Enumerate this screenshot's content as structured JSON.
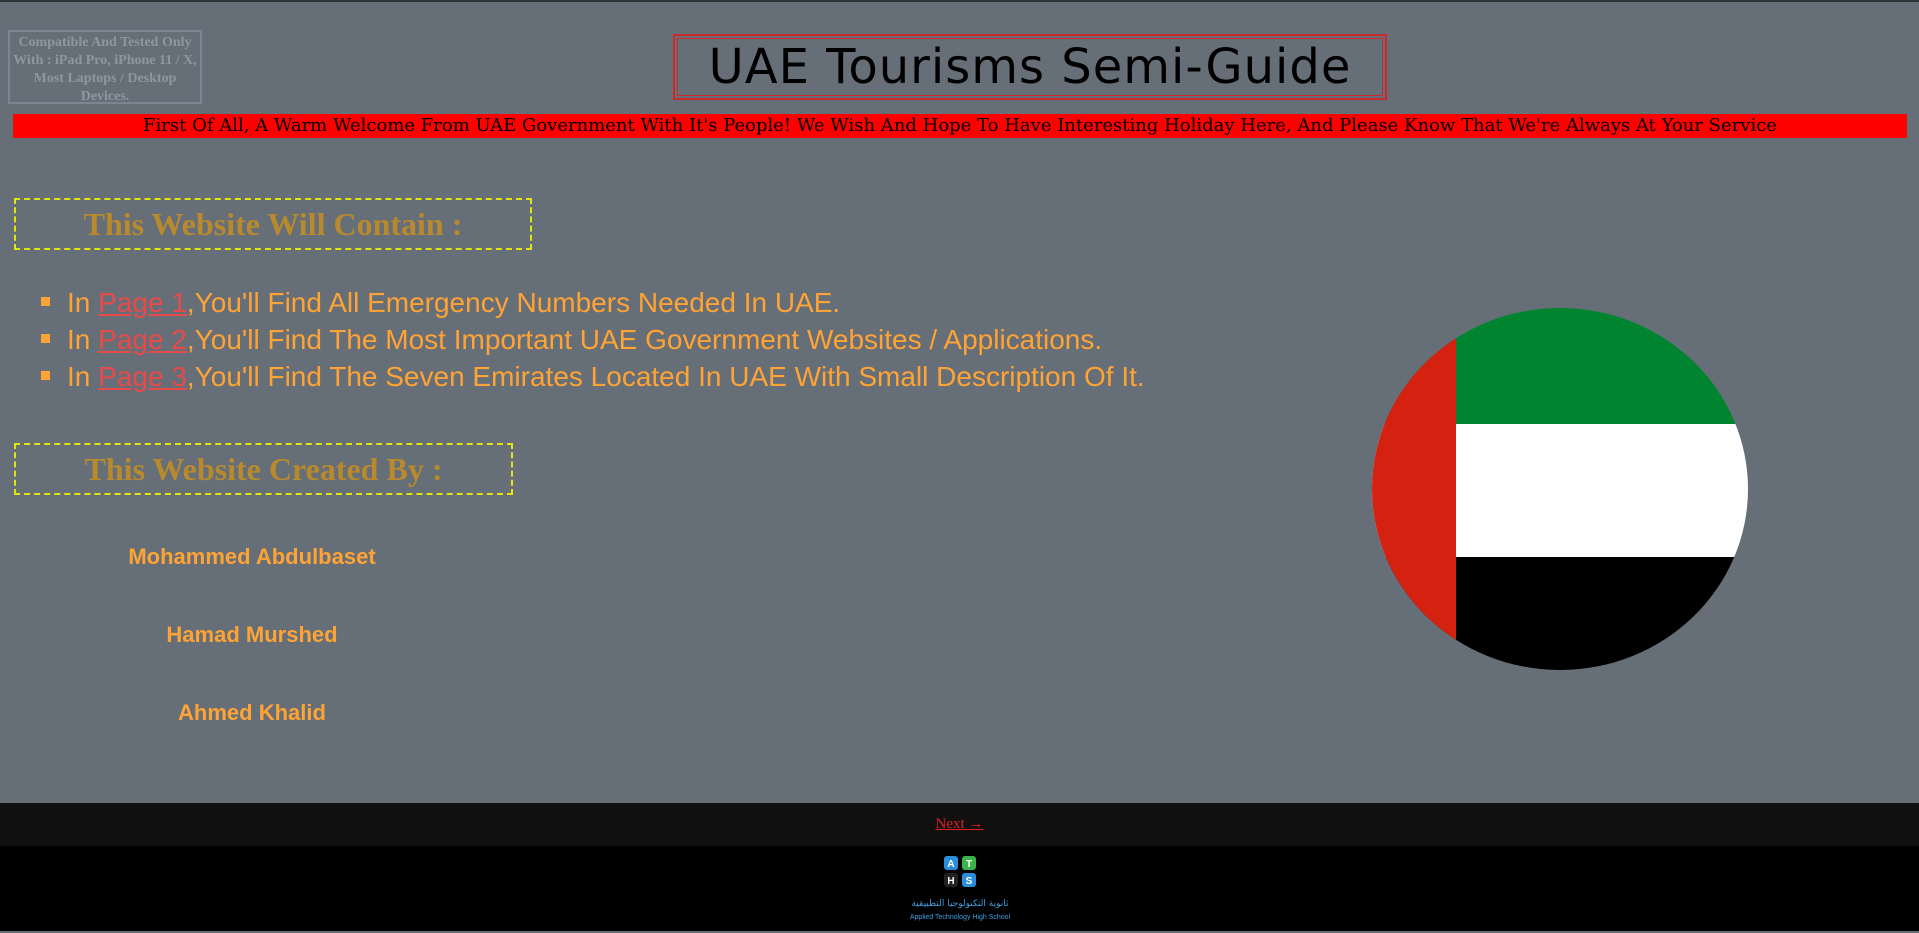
{
  "compat_notice": "Compatible And Tested Only With : iPad Pro, iPhone 11 / X, Most Laptops / Desktop Devices.",
  "title": "UAE Tourisms Semi-Guide",
  "welcome": "First Of All, A Warm Welcome From UAE Government With It's People! We Wish And Hope To Have Interesting Holiday Here, And Please Know That We're Always At Your Service",
  "contain_heading": "This Website Will Contain :",
  "contents": [
    {
      "prefix": "In ",
      "link": "Page 1",
      "text": ",You'll Find All Emergency Numbers Needed In UAE."
    },
    {
      "prefix": "In ",
      "link": "Page 2",
      "text": ",You'll Find The Most Important UAE Government Websites / Applications."
    },
    {
      "prefix": "In ",
      "link": "Page 3",
      "text": ",You'll Find The Seven Emirates Located In UAE With Small Description Of It."
    }
  ],
  "created_heading": "This Website Created By :",
  "authors": [
    "Mohammed Abdulbaset",
    "Hamad Murshed",
    "Ahmed Khalid"
  ],
  "footer": {
    "next_label": "Next →"
  },
  "logo": {
    "letters": [
      "A",
      "T",
      "H",
      "S"
    ],
    "arabic": "ثانوية التكنولوجيا التطبيقية",
    "english": "Applied Technology High School"
  },
  "flag_colors": {
    "red": "#d5210f",
    "green": "#00842f",
    "white": "#ffffff",
    "black": "#000000"
  },
  "colors": {
    "heading": "#b8892d",
    "orange_text": "#ffa334",
    "link": "#e84a4a",
    "welcome_bg": "#ff0000"
  }
}
